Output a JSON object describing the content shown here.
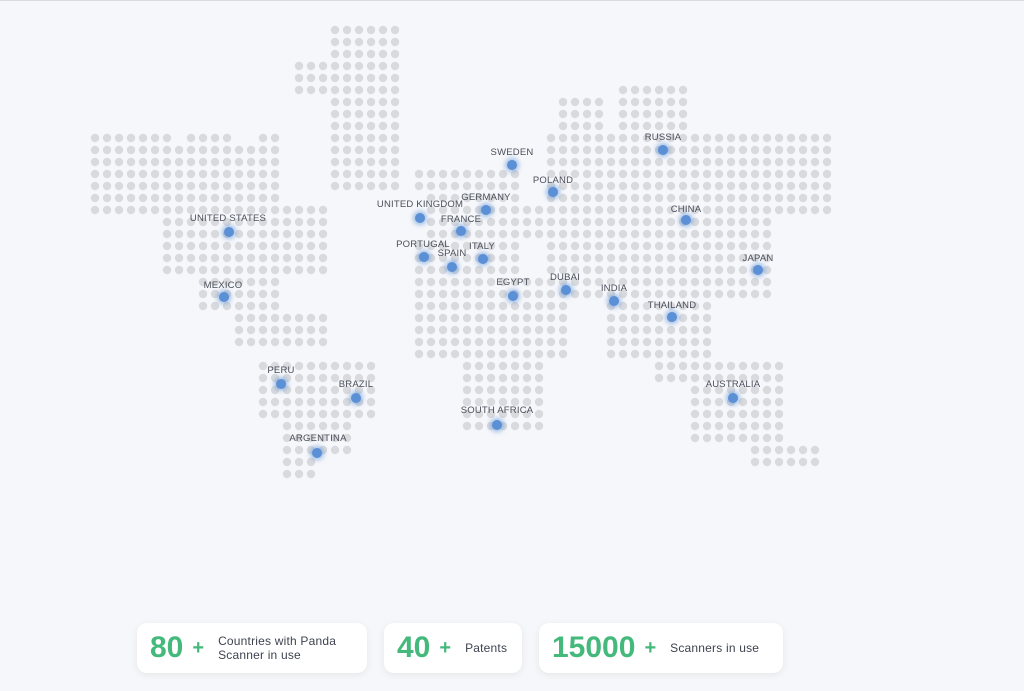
{
  "map": {
    "dot_color": "#d9dadd",
    "pin_color": "#5b8fd6",
    "locations": [
      {
        "id": "russia",
        "label": "RUSSIA"
      },
      {
        "id": "sweden",
        "label": "SWEDEN"
      },
      {
        "id": "poland",
        "label": "POLAND"
      },
      {
        "id": "germany",
        "label": "GERMANY"
      },
      {
        "id": "united-kingdom",
        "label": "UNITED KINGDOM"
      },
      {
        "id": "france",
        "label": "FRANCE"
      },
      {
        "id": "portugal",
        "label": "PORTUGAL"
      },
      {
        "id": "spain",
        "label": "SPAIN"
      },
      {
        "id": "italy",
        "label": "ITALY"
      },
      {
        "id": "united-states",
        "label": "UNITED STATES"
      },
      {
        "id": "mexico",
        "label": "MEXICO"
      },
      {
        "id": "china",
        "label": "CHINA"
      },
      {
        "id": "japan",
        "label": "JAPAN"
      },
      {
        "id": "egypt",
        "label": "EGYPT"
      },
      {
        "id": "dubai",
        "label": "DUBAI"
      },
      {
        "id": "india",
        "label": "INDIA"
      },
      {
        "id": "thailand",
        "label": "THAILAND"
      },
      {
        "id": "peru",
        "label": "PERU"
      },
      {
        "id": "brazil",
        "label": "BRAZIL"
      },
      {
        "id": "south-africa",
        "label": "SOUTH AFRICA"
      },
      {
        "id": "argentina",
        "label": "ARGENTINA"
      },
      {
        "id": "australia",
        "label": "AUSTRALIA"
      }
    ]
  },
  "stats": [
    {
      "number": "80",
      "plus": "+",
      "label": "Countries with Panda Scanner in use"
    },
    {
      "number": "40",
      "plus": "+",
      "label": "Patents"
    },
    {
      "number": "15000",
      "plus": "+",
      "label": "Scanners in use"
    }
  ],
  "colors": {
    "accent": "#45b97c",
    "background": "#f6f7fa"
  }
}
